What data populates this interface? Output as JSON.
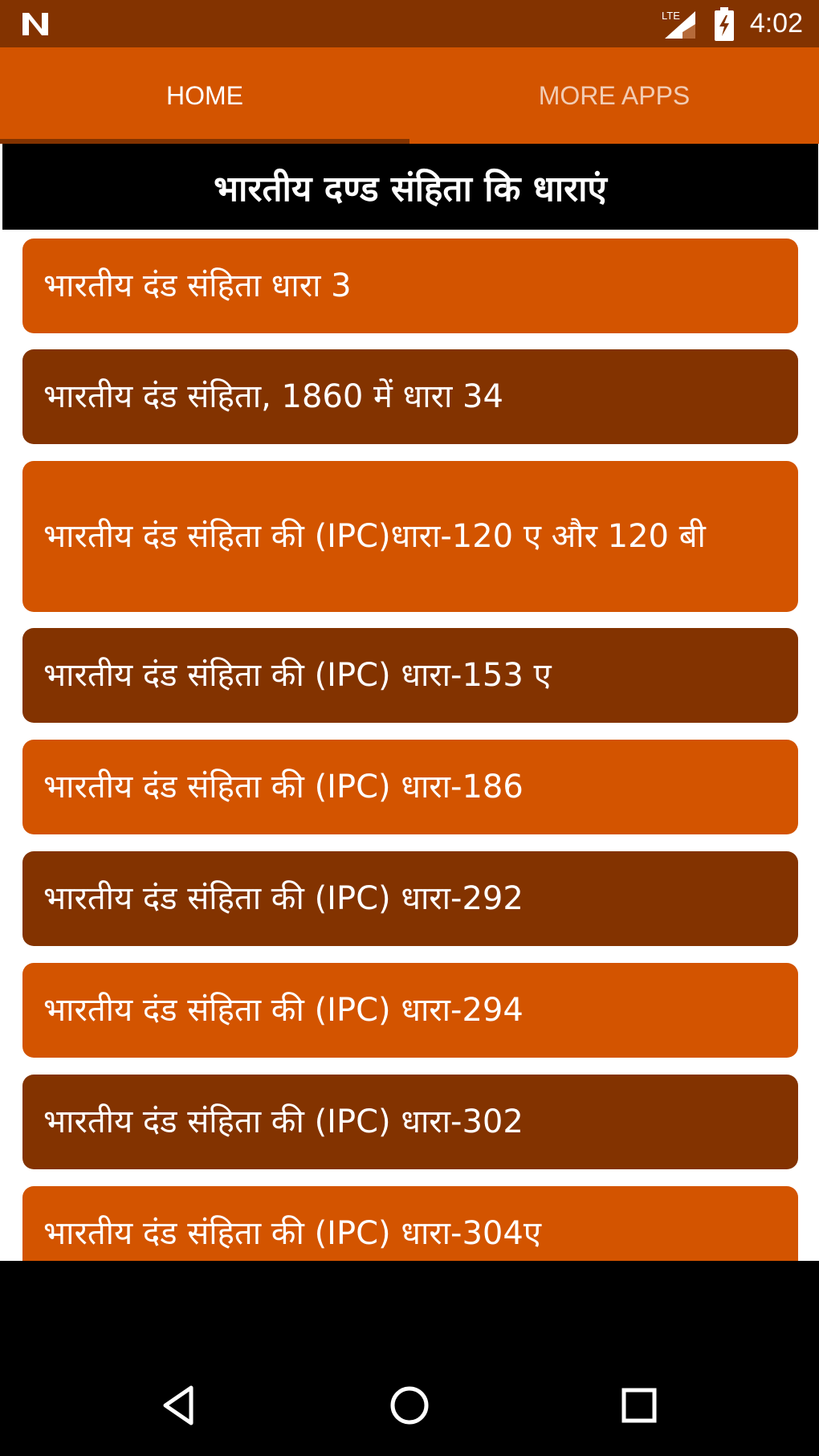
{
  "status_bar": {
    "time": "4:02",
    "icons": [
      "notification-n-icon",
      "lte-signal-icon",
      "battery-charging-icon"
    ],
    "lte_label": "LTE"
  },
  "tabs": [
    {
      "label": "HOME",
      "active": true
    },
    {
      "label": "MORE APPS",
      "active": false
    }
  ],
  "header": {
    "title": "भारतीय दण्ड संहिता कि धाराएं"
  },
  "list_items": [
    {
      "label": "भारतीय दंड संहिता धारा 3",
      "color": "orange"
    },
    {
      "label": "भारतीय दंड संहिता, 1860 में धारा 34",
      "color": "brown"
    },
    {
      "label": "भारतीय दंड संहिता की (IPC)धारा-120 ए और 120 बी",
      "color": "orange"
    },
    {
      "label": "भारतीय दंड संहिता की (IPC) धारा-153 ए",
      "color": "brown"
    },
    {
      "label": "भारतीय दंड संहिता की (IPC) धारा-186",
      "color": "orange"
    },
    {
      "label": "भारतीय दंड संहिता की (IPC) धारा-292",
      "color": "brown"
    },
    {
      "label": "भारतीय दंड संहिता की (IPC) धारा-294",
      "color": "orange"
    },
    {
      "label": "भारतीय दंड संहिता की (IPC) धारा-302",
      "color": "brown"
    },
    {
      "label": "भारतीय दंड संहिता की (IPC) धारा-304ए",
      "color": "orange"
    }
  ],
  "nav_bar": {
    "icons": [
      "back-icon",
      "home-icon",
      "recents-icon"
    ]
  },
  "colors": {
    "primary": "#d35400",
    "dark": "#833300",
    "header": "#000000"
  }
}
